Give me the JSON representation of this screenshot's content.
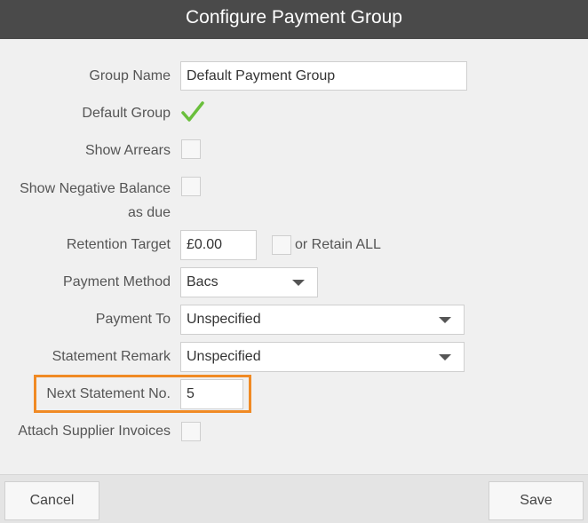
{
  "dialog": {
    "title": "Configure Payment Group"
  },
  "form": {
    "group_name": {
      "label": "Group Name",
      "value": "Default Payment Group"
    },
    "default_group": {
      "label": "Default Group",
      "checked": true
    },
    "show_arrears": {
      "label": "Show Arrears",
      "checked": false
    },
    "show_negative_balance": {
      "label_line1": "Show Negative Balance",
      "label_line2": "as due",
      "checked": false
    },
    "retention_target": {
      "label": "Retention Target",
      "value": "£0.00",
      "retain_all_label": "or Retain ALL",
      "retain_all_checked": false
    },
    "payment_method": {
      "label": "Payment Method",
      "value": "Bacs"
    },
    "payment_to": {
      "label": "Payment To",
      "value": "Unspecified"
    },
    "statement_remark": {
      "label": "Statement Remark",
      "value": "Unspecified"
    },
    "next_statement_no": {
      "label": "Next Statement No.",
      "value": "5"
    },
    "attach_supplier_invoices": {
      "label": "Attach Supplier Invoices",
      "checked": false
    }
  },
  "footer": {
    "cancel_label": "Cancel",
    "save_label": "Save"
  },
  "colors": {
    "titlebar": "#4a4a4a",
    "highlight": "#f08a24",
    "check": "#6abf3c"
  }
}
